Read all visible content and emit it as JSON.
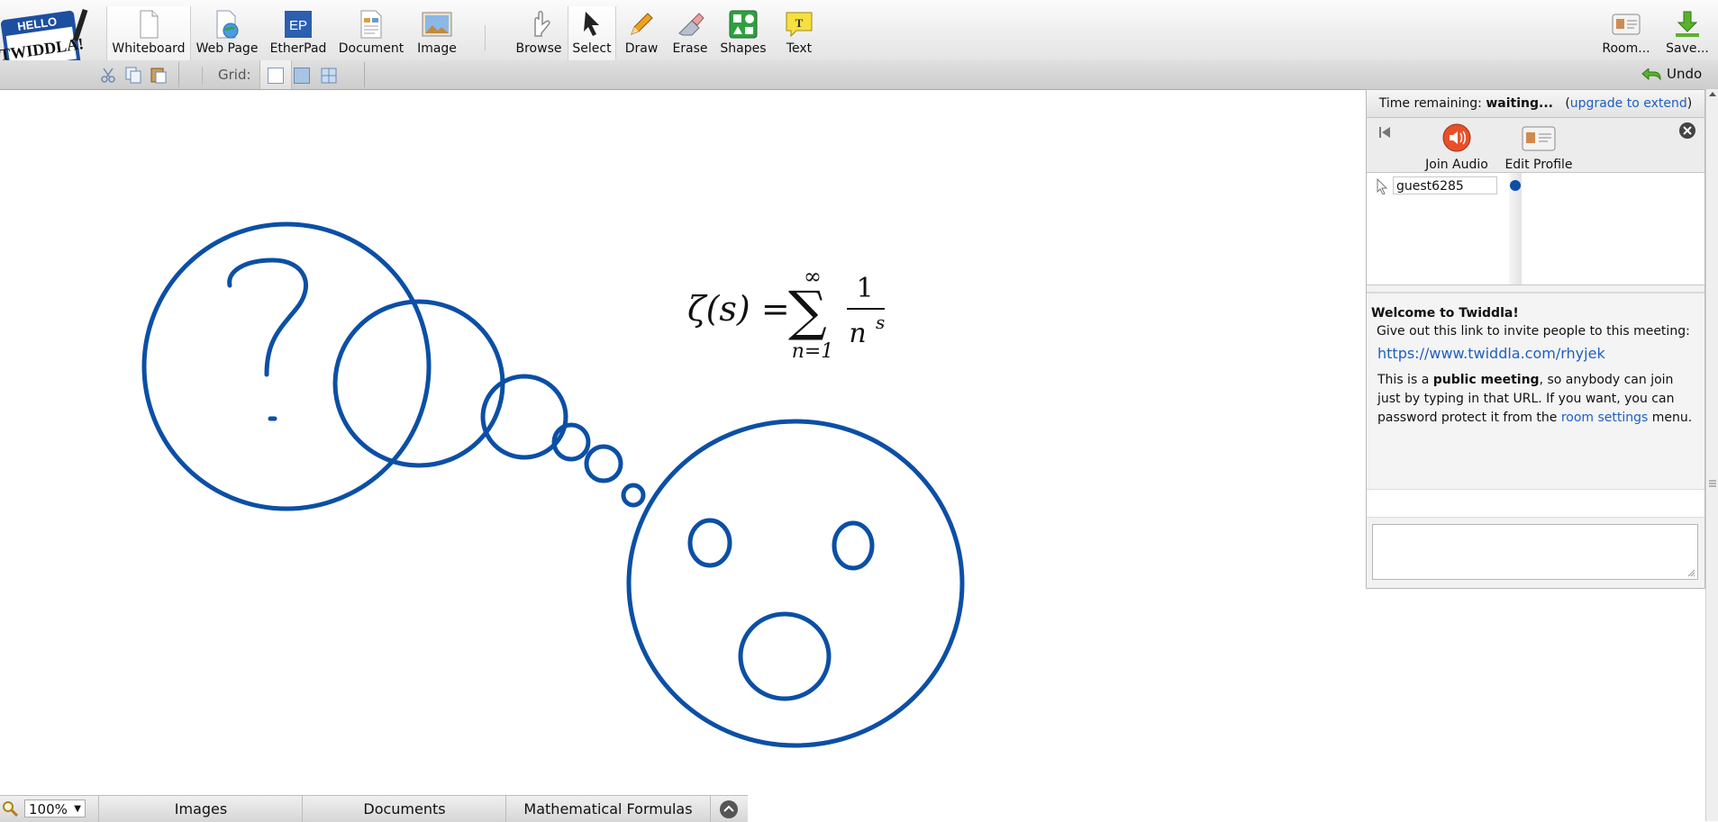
{
  "toolbar": {
    "logo_text_top": "HELLO",
    "logo_text_main": "TWIDDLA!",
    "tools": [
      {
        "id": "whiteboard",
        "label": "Whiteboard",
        "icon": "page-icon",
        "active": true
      },
      {
        "id": "webpage",
        "label": "Web Page",
        "icon": "globe-page-icon"
      },
      {
        "id": "etherpad",
        "label": "EtherPad",
        "icon": "etherpad-icon",
        "icon_text": "EP"
      },
      {
        "id": "document",
        "label": "Document",
        "icon": "document-icon"
      },
      {
        "id": "image",
        "label": "Image",
        "icon": "picture-icon"
      },
      {
        "id": "browse",
        "label": "Browse",
        "icon": "hand-icon"
      },
      {
        "id": "select",
        "label": "Select",
        "icon": "arrow-cursor-icon",
        "active": true
      },
      {
        "id": "draw",
        "label": "Draw",
        "icon": "pencil-icon"
      },
      {
        "id": "erase",
        "label": "Erase",
        "icon": "eraser-icon"
      },
      {
        "id": "shapes",
        "label": "Shapes",
        "icon": "shapes-icon"
      },
      {
        "id": "text",
        "label": "Text",
        "icon": "text-bubble-icon",
        "icon_text": "T"
      }
    ],
    "room_label": "Room...",
    "save_label": "Save..."
  },
  "subbar": {
    "grid_label": "Grid:",
    "undo_label": "Undo"
  },
  "canvas": {
    "formula_lhs": "ζ(s) =",
    "formula_sum_top": "∞",
    "formula_sum_bottom": "n=1",
    "formula_numerator": "1",
    "formula_denominator": "n",
    "formula_exponent": "s",
    "stroke_color": "#0b4fa6"
  },
  "panel": {
    "time_label": "Time remaining:",
    "time_value": "waiting...",
    "upgrade_link": "upgrade to extend",
    "join_audio": "Join Audio",
    "edit_profile": "Edit Profile",
    "username": "guest6285",
    "welcome_title": "Welcome to Twiddla!",
    "welcome_invite": "Give out this link to invite people to this meeting:",
    "meeting_url": "https://www.twiddla.com/rhyjek",
    "public_pre": "This is a ",
    "public_bold": "public meeting",
    "public_post": ", so anybody can join just by typing in that URL. If you want, you can password protect it from the ",
    "room_settings_link": "room settings",
    "public_end": " menu."
  },
  "bottom": {
    "zoom": "100%",
    "tabs": [
      "Images",
      "Documents",
      "Mathematical Formulas"
    ]
  }
}
